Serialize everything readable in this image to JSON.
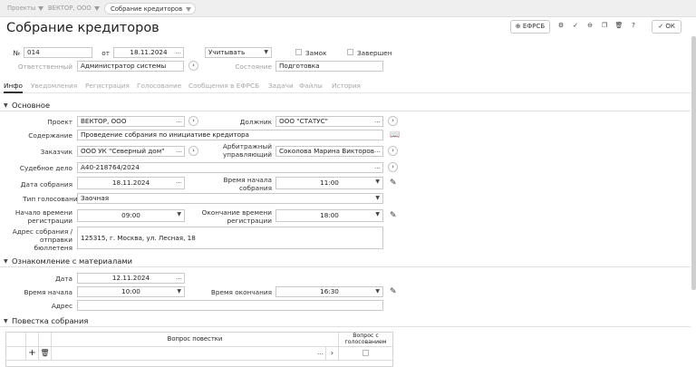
{
  "breadcrumbs": [
    {
      "label": "Проекты"
    },
    {
      "label": "ВЕКТОР, ООО"
    },
    {
      "label": "Собрание кредиторов"
    }
  ],
  "page_title": "Собрание кредиторов",
  "toolbar": {
    "efrsb_label": "ЕФРСБ",
    "ok_label": "ОК"
  },
  "header": {
    "num_label": "№",
    "num_value": "014",
    "from_label": "от",
    "date_value": "18.11.2024",
    "account_value": "Учитывать",
    "lock_label": "Замок",
    "done_label": "Завершен",
    "responsible_label": "Ответственный",
    "responsible_value": "Администратор системы",
    "state_label": "Состояние",
    "state_value": "Подготовка"
  },
  "tabs": [
    {
      "label": "Инфо"
    },
    {
      "label": "Уведомления"
    },
    {
      "label": "Регистрация"
    },
    {
      "label": "Голосование"
    },
    {
      "label": "Сообщения в ЕФРСБ"
    },
    {
      "label": "Задачи"
    },
    {
      "label": "Файлы"
    },
    {
      "label": "История"
    }
  ],
  "main": {
    "title": "Основное",
    "project_label": "Проект",
    "project_value": "ВЕКТОР, ООО",
    "debtor_label": "Должник",
    "debtor_value": "ООО \"СТАТУС\"",
    "content_label": "Содержание",
    "content_value": "Проведение собрания по инициативе кредитора",
    "customer_label": "Заказчик",
    "customer_value": "ООО УК \"Северный дом\"",
    "manager_label_1": "Арбитражный",
    "manager_label_2": "управляющий",
    "manager_value": "Соколова Марина Викторовн",
    "case_label": "Судебное дело",
    "case_value": "А40-218764/2024",
    "meeting_date_label": "Дата собрания",
    "meeting_date_value": "18.11.2024",
    "start_label_1": "Время начала",
    "start_label_2": "собрания",
    "start_value": "11:00",
    "vote_type_label": "Тип голосования",
    "vote_type_value": "Заочная",
    "reg_start_label_1": "Начало времени",
    "reg_start_label_2": "регистрации",
    "reg_start_value": "09:00",
    "reg_end_label_1": "Окончание времени",
    "reg_end_label_2": "регистрации",
    "reg_end_value": "18:00",
    "address_label_1": "Адрес собрания /",
    "address_label_2": "отправки",
    "address_label_3": "бюллетеня",
    "address_value": "125315, г. Москва, ул. Лесная, 18"
  },
  "materials": {
    "title": "Ознакомление с материалами",
    "date_label": "Дата",
    "date_value": "12.11.2024",
    "start_label": "Время начала",
    "start_value": "10:00",
    "end_label": "Время окончания",
    "end_value": "16:30",
    "address_label": "Адрес",
    "address_value": ""
  },
  "agenda": {
    "title": "Повестка собрания",
    "col_question": "Вопрос повестки",
    "col_vote_1": "Вопрос с",
    "col_vote_2": "голосованием"
  }
}
